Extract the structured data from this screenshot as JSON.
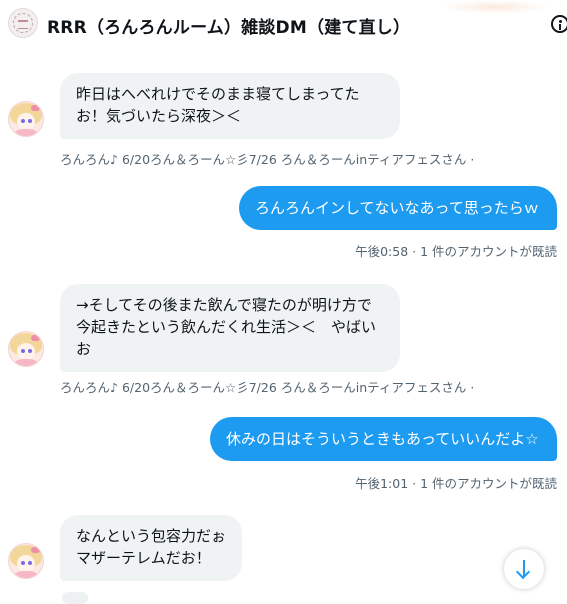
{
  "header": {
    "title": "RRR（ろんろんルーム）雑談DM（建て直し）"
  },
  "messages": [
    {
      "direction": "in",
      "text": "昨日はへべれけでそのまま寝てしまってた\nお！気づいたら深夜＞＜",
      "meta": "ろんろん♪ 6/20ろん＆ろーん☆彡7/26 ろん＆ろーんinティアフェスさん ·"
    },
    {
      "direction": "out",
      "text": "ろんろんインしてないなあって思ったらｗ",
      "meta": "午後0:58 · 1 件のアカウントが既読"
    },
    {
      "direction": "in",
      "text": "→そしてその後また飲んで寝たのが明け方で\n今起きたという飲んだくれ生活＞＜　やばい\nお",
      "meta": "ろんろん♪ 6/20ろん＆ろーん☆彡7/26 ろん＆ろーんinティアフェスさん ·"
    },
    {
      "direction": "out",
      "text": "休みの日はそういうときもあっていいんだよ☆",
      "meta": "午後1:01 · 1 件のアカウントが既読"
    },
    {
      "direction": "in",
      "text": "なんという包容力だぉ\nマザーテレムだお！",
      "meta": ""
    }
  ],
  "icons": {
    "info": "info-icon",
    "scroll_down": "arrow-down-icon",
    "avatar": "user-avatar",
    "group_avatar": "group-avatar"
  },
  "colors": {
    "accent": "#1d9bf0",
    "incoming_bubble": "#eff3f4",
    "meta_text": "#536471",
    "text": "#0f1419"
  }
}
